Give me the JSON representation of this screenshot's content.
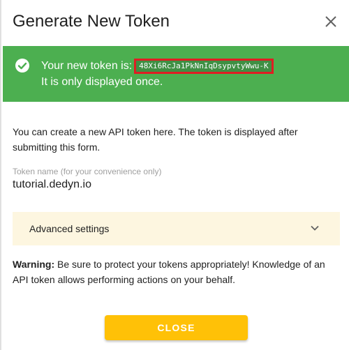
{
  "dialog": {
    "title": "Generate New Token",
    "close_icon": "close-icon"
  },
  "alert": {
    "icon": "check-circle-icon",
    "message_prefix": "Your new token is:",
    "token": "48Xi6RcJa1PkNnIqDsypvtyWwu-K",
    "message_suffix": "It is only displayed once.",
    "color": "#4caf50"
  },
  "intro_text": "You can create a new API token here. The token is displayed after submitting this form.",
  "token_name": {
    "label": "Token name (for your convenience only)",
    "value": "tutorial.dedyn.io"
  },
  "advanced": {
    "label": "Advanced settings",
    "icon": "chevron-down-icon"
  },
  "warning": {
    "label": "Warning:",
    "text": " Be sure to protect your tokens appropriately! Knowledge of an API token allows performing actions on your behalf."
  },
  "actions": {
    "close_label": "CLOSE",
    "accent": "#ffc107"
  }
}
